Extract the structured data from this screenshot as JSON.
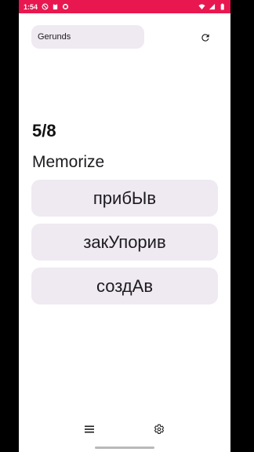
{
  "status_bar": {
    "time": "1:54",
    "background": "#e8174f",
    "left_icons": [
      "block-icon",
      "clipboard-icon",
      "app-notification-icon"
    ],
    "right_icons": [
      "wifi-icon",
      "signal-icon",
      "battery-icon"
    ]
  },
  "deck": {
    "name": "Gerunds"
  },
  "toolbar": {
    "refresh_icon": "refresh-icon"
  },
  "progress": {
    "text": "5/8",
    "current": 5,
    "total": 8
  },
  "mode": {
    "title": "Memorize"
  },
  "answers": [
    {
      "label": "прибЫв"
    },
    {
      "label": "закУпорив"
    },
    {
      "label": "создАв"
    }
  ],
  "bottom_nav": {
    "menu_icon": "menu-icon",
    "settings_icon": "gear-icon"
  },
  "colors": {
    "card": "#efe9f1",
    "text": "#1c1b1f"
  }
}
